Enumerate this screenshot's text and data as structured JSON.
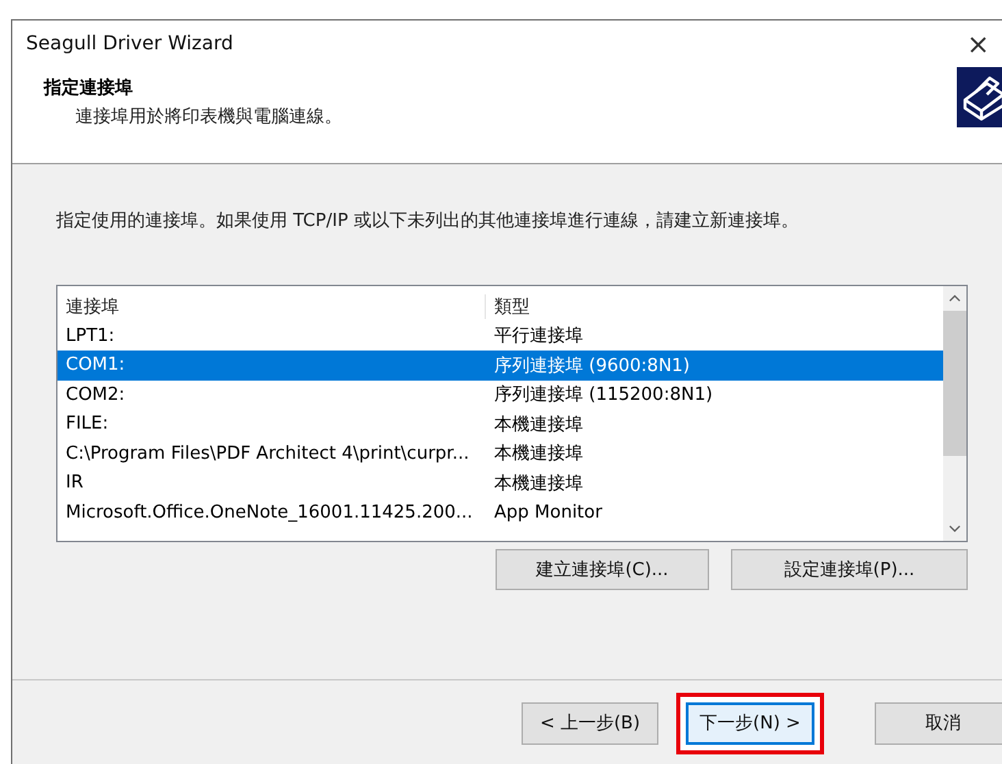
{
  "window": {
    "title": "Seagull Driver Wizard",
    "close": "×"
  },
  "header": {
    "title": "指定連接埠",
    "subtitle": "連接埠用於將印表機與電腦連線。"
  },
  "instruction": "指定使用的連接埠。如果使用 TCP/IP 或以下未列出的其他連接埠進行連線，請建立新連接埠。",
  "table": {
    "columns": [
      "連接埠",
      "類型"
    ],
    "rows": [
      {
        "port": "LPT1:",
        "type": "平行連接埠",
        "selected": false
      },
      {
        "port": "COM1:",
        "type": "序列連接埠 (9600:8N1)",
        "selected": true
      },
      {
        "port": "COM2:",
        "type": "序列連接埠 (115200:8N1)",
        "selected": false
      },
      {
        "port": "FILE:",
        "type": "本機連接埠",
        "selected": false
      },
      {
        "port": "C:\\Program Files\\PDF Architect 4\\print\\curpr...",
        "type": "本機連接埠",
        "selected": false
      },
      {
        "port": "IR",
        "type": "本機連接埠",
        "selected": false
      },
      {
        "port": "Microsoft.Office.OneNote_16001.11425.200...",
        "type": "App Monitor",
        "selected": false
      }
    ]
  },
  "port_buttons": [
    "建立連接埠(C)...",
    "設定連接埠(P)..."
  ],
  "nav_buttons": [
    {
      "label": "< 上一步(B)",
      "focused": false,
      "highlighted": false
    },
    {
      "label": "下一步(N) >",
      "focused": true,
      "highlighted": true
    },
    {
      "label": "取消",
      "focused": false,
      "highlighted": false
    }
  ]
}
